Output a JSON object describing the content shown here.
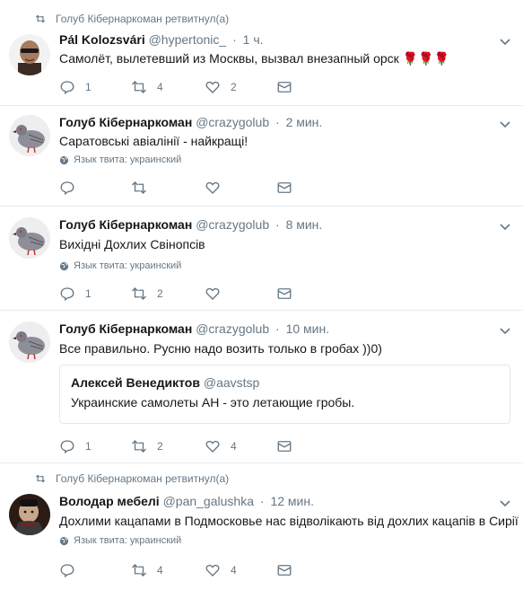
{
  "tweets": [
    {
      "retweeted_by": "Голуб Кібернаркоман ретвитнул(а)",
      "name": "Pál Kolozsvári",
      "handle": "@hypertonic_",
      "dot": "·",
      "time": "1 ч.",
      "text": "Самолёт, вылетевший из Москвы, вызвал внезапный орск",
      "emoji": "🌹🌹🌹",
      "reply_count": "1",
      "retweet_count": "4",
      "like_count": "2",
      "avatar": "bald-man-sunglasses"
    },
    {
      "name": "Голуб Кібернаркоман",
      "handle": "@crazygolub",
      "dot": "·",
      "time": "2 мин.",
      "text": "Саратовські авіалінії - найкращі!",
      "lang": "Язык твита: украинский",
      "reply_count": "",
      "retweet_count": "",
      "like_count": "",
      "avatar": "pigeon"
    },
    {
      "name": "Голуб Кібернаркоман",
      "handle": "@crazygolub",
      "dot": "·",
      "time": "8 мин.",
      "text": "Вихідні Дохлих Свінопсів",
      "lang": "Язык твита: украинский",
      "reply_count": "1",
      "retweet_count": "2",
      "like_count": "",
      "avatar": "pigeon"
    },
    {
      "name": "Голуб Кібернаркоман",
      "handle": "@crazygolub",
      "dot": "·",
      "time": "10 мин.",
      "text": "Все правильно. Русню надо возить только в гробах ))0)",
      "quote": {
        "name": "Алексей Венедиктов",
        "handle": "@aavstsp",
        "text": "Украинские самолеты АН - это летающие гробы."
      },
      "reply_count": "1",
      "retweet_count": "2",
      "like_count": "4",
      "avatar": "pigeon"
    },
    {
      "retweeted_by": "Голуб Кібернаркоман ретвитнул(а)",
      "name": "Володар мебелі",
      "handle": "@pan_galushka",
      "dot": "·",
      "time": "12 мин.",
      "text": "Дохлими кацапами в Подмосковье нас відволікають від дохлих кацапів в Сирії",
      "lang": "Язык твита: украинский",
      "reply_count": "",
      "retweet_count": "4",
      "like_count": "4",
      "avatar": "armored-figure"
    }
  ],
  "colors": {
    "text": "#14171a",
    "muted": "#657786",
    "border": "#e6ecf0"
  }
}
